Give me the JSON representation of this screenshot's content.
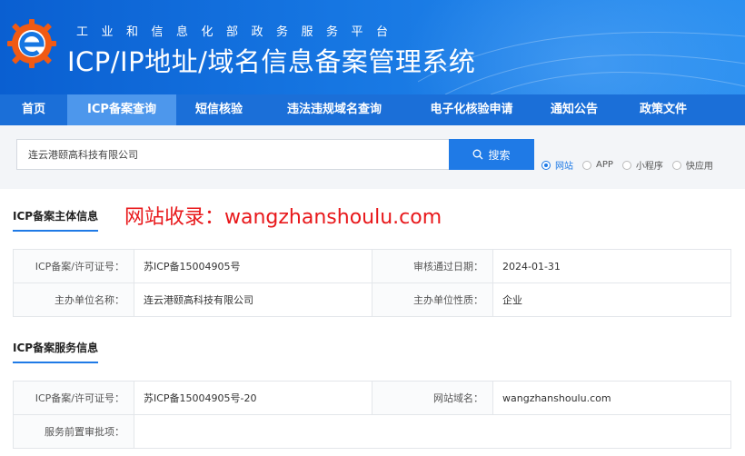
{
  "header": {
    "subtitle": "工业和信息化部政务服务平台",
    "title": "ICP/IP地址/域名信息备案管理系统"
  },
  "nav": [
    {
      "label": "首页",
      "active": false
    },
    {
      "label": "ICP备案查询",
      "active": true
    },
    {
      "label": "短信核验",
      "active": false
    },
    {
      "label": "违法违规域名查询",
      "active": false
    },
    {
      "label": "电子化核验申请",
      "active": false
    },
    {
      "label": "通知公告",
      "active": false
    },
    {
      "label": "政策文件",
      "active": false
    }
  ],
  "search": {
    "value": "连云港颐高科技有限公司",
    "button_label": "搜索",
    "radios": [
      {
        "label": "网站",
        "checked": true
      },
      {
        "label": "APP",
        "checked": false
      },
      {
        "label": "小程序",
        "checked": false
      },
      {
        "label": "快应用",
        "checked": false
      }
    ]
  },
  "watermark": "网站收录：wangzhanshoulu.com",
  "subject_section": {
    "title": "ICP备案主体信息",
    "rows": [
      {
        "k1": "ICP备案/许可证号：",
        "v1": "苏ICP备15004905号",
        "k2": "审核通过日期：",
        "v2": "2024-01-31"
      },
      {
        "k1": "主办单位名称：",
        "v1": "连云港颐高科技有限公司",
        "k2": "主办单位性质：",
        "v2": "企业"
      }
    ]
  },
  "service_section": {
    "title": "ICP备案服务信息",
    "rows": [
      {
        "k1": "ICP备案/许可证号：",
        "v1": "苏ICP备15004905号-20",
        "k2": "网站域名：",
        "v2": "wangzhanshoulu.com"
      },
      {
        "k1": "服务前置审批项：",
        "v1": "",
        "k2": "",
        "v2": ""
      }
    ]
  },
  "colors": {
    "primary": "#1f7ae6",
    "nav": "#1b6fd8",
    "nav_active": "#4d97ec",
    "watermark": "#e8181b",
    "logo_orange": "#f05a14"
  }
}
